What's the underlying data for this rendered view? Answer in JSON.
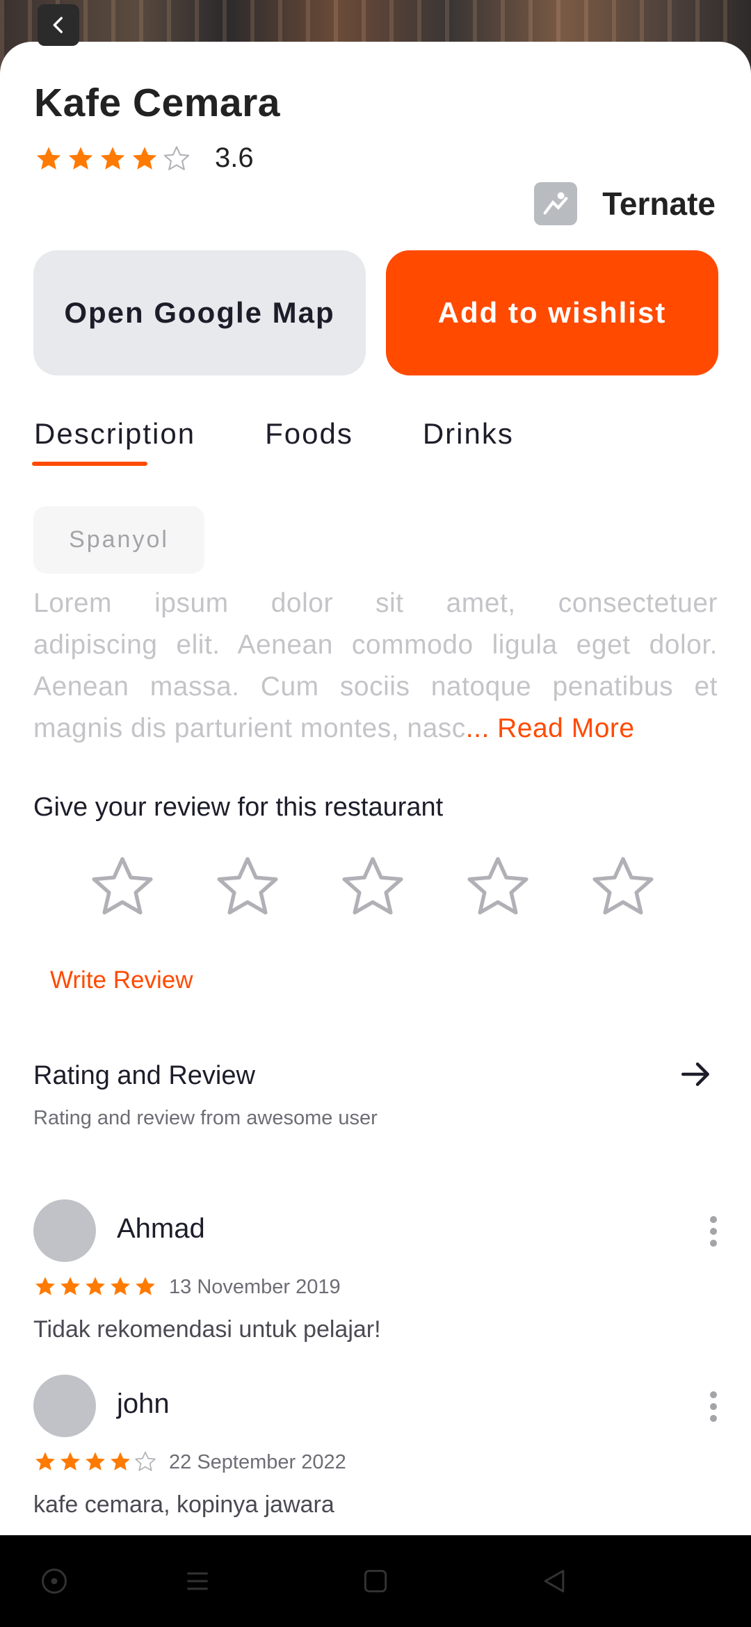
{
  "header": {
    "back_icon": "chevron-left-icon"
  },
  "restaurant": {
    "name": "Kafe Cemara",
    "rating_value": "3.6",
    "rating_stars": 3.6,
    "location": "Ternate",
    "location_icon": "map-placeholder-icon"
  },
  "actions": {
    "open_map_label": "Open Google Map",
    "wishlist_label": "Add to wishlist"
  },
  "tabs": [
    {
      "label": "Description",
      "active": true
    },
    {
      "label": "Foods",
      "active": false
    },
    {
      "label": "Drinks",
      "active": false
    }
  ],
  "description": {
    "tag": "Spanyol",
    "lines": [
      "Lorem ipsum dolor sit amet, consectetuer",
      "adipiscing elit. Aenean commodo ligula eget dolor.",
      "Aenean massa. Cum sociis natoque penatibus et"
    ],
    "last_line": "magnis dis parturient montes, nasc",
    "read_more": "... Read More"
  },
  "review_prompt": {
    "title": "Give your review for this restaurant",
    "star_count": 5,
    "write_review_label": "Write Review"
  },
  "rating_review": {
    "title": "Rating and Review",
    "subtitle": "Rating and review from awesome user",
    "arrow_icon": "arrow-right-icon"
  },
  "reviews": [
    {
      "name": "Ahmad",
      "stars": 5,
      "date": "13 November 2019",
      "text": "Tidak rekomendasi untuk pelajar!"
    },
    {
      "name": "john",
      "stars": 4,
      "date": "22 September 2022",
      "text": "kafe cemara, kopinya jawara"
    }
  ],
  "colors": {
    "accent": "#ff4a00",
    "star_filled": "#ff7a00",
    "star_empty": "#b0b0b6"
  },
  "navbar": {
    "icons": [
      "circle-dot-icon",
      "menu-icon",
      "square-home-icon",
      "triangle-back-icon"
    ]
  }
}
